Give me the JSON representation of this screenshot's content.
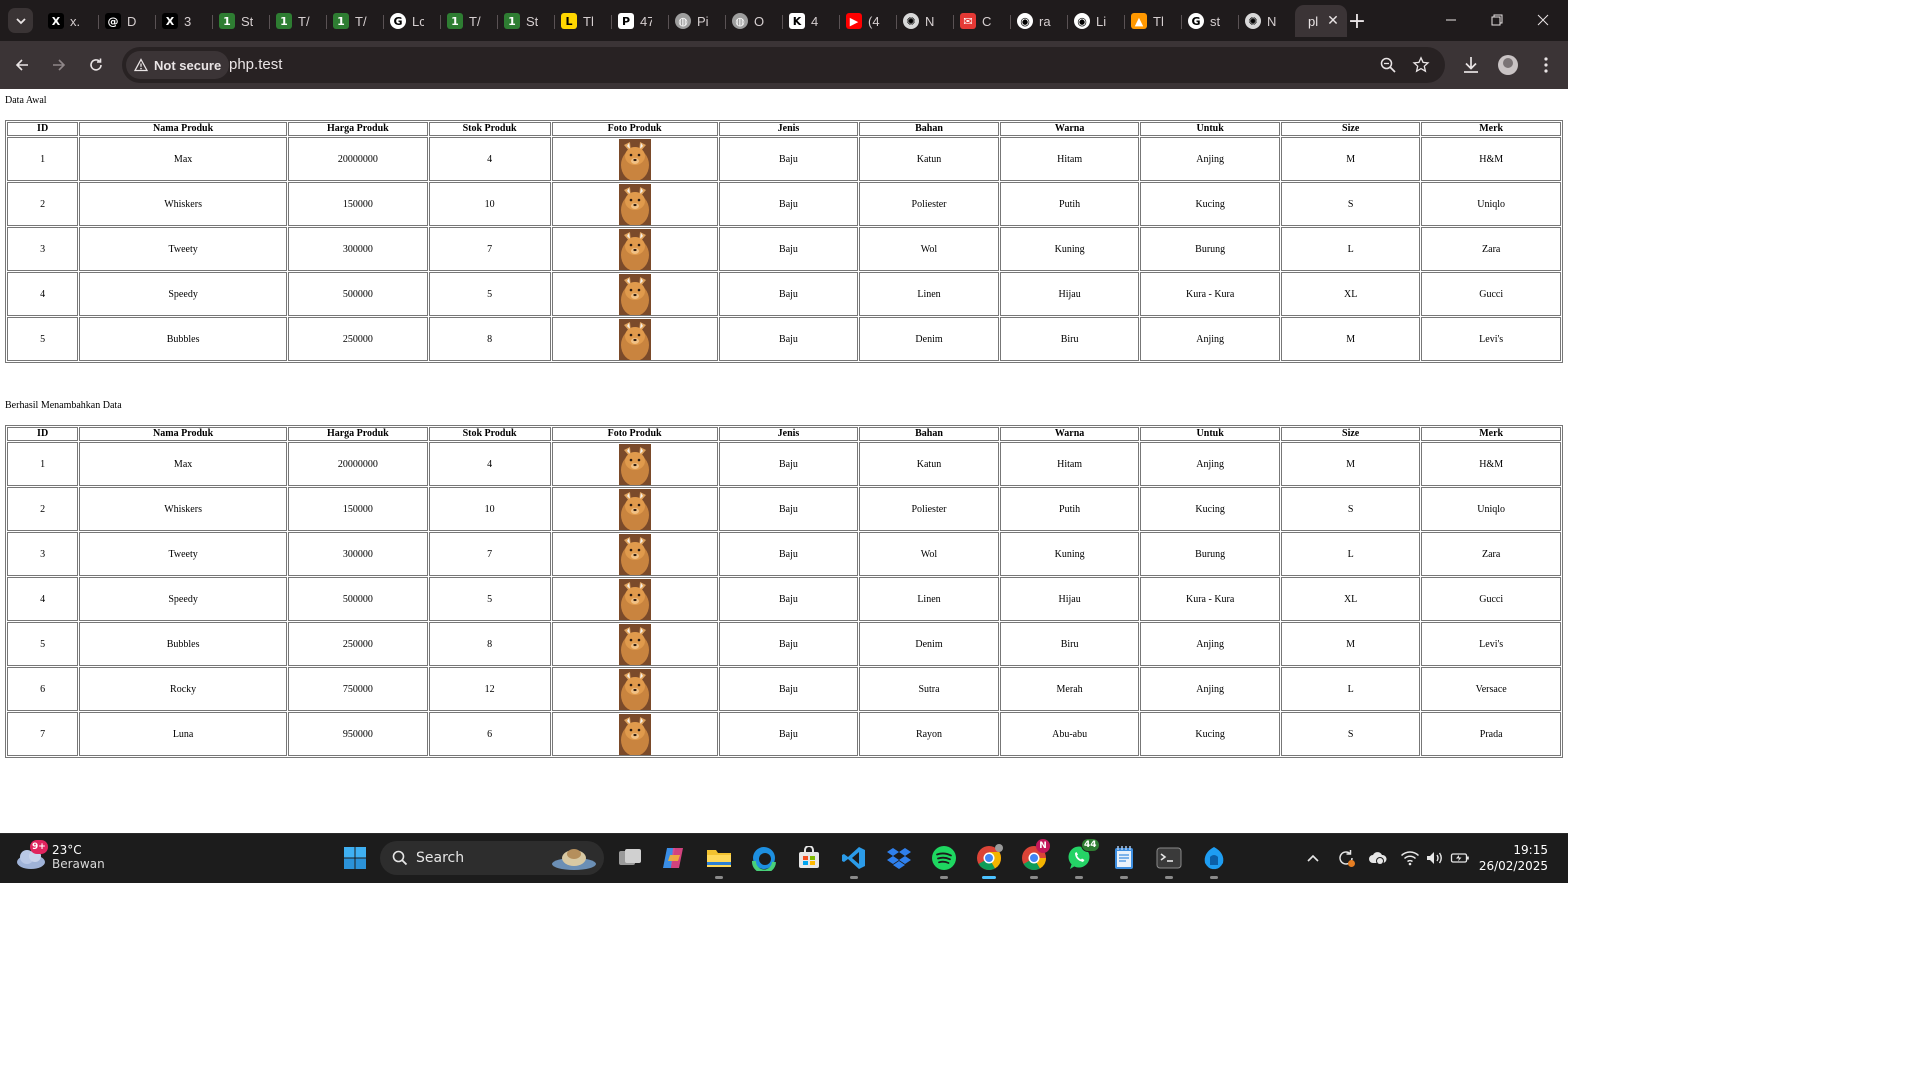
{
  "browser": {
    "tabs": [
      {
        "title": "x.",
        "icon": "x-logo-icon",
        "color": "#000000",
        "glyph": "X"
      },
      {
        "title": "D",
        "icon": "threads-icon",
        "color": "#000000",
        "glyph": "@"
      },
      {
        "title": "3",
        "icon": "x-logo-icon",
        "color": "#000000",
        "glyph": "X"
      },
      {
        "title": "St",
        "icon": "123dok-icon",
        "color": "#2e7d32",
        "glyph": "1"
      },
      {
        "title": "T/",
        "icon": "123dok-icon",
        "color": "#2e7d32",
        "glyph": "1"
      },
      {
        "title": "T/",
        "icon": "123dok-icon",
        "color": "#2e7d32",
        "glyph": "1"
      },
      {
        "title": "Lc",
        "icon": "google-icon",
        "color": "#ffffff",
        "glyph": "G"
      },
      {
        "title": "T/",
        "icon": "123dok-icon",
        "color": "#2e7d32",
        "glyph": "1"
      },
      {
        "title": "St",
        "icon": "123dok-icon",
        "color": "#2e7d32",
        "glyph": "1"
      },
      {
        "title": "Tl",
        "icon": "tl-icon",
        "color": "#ffd600",
        "glyph": "L"
      },
      {
        "title": "47",
        "icon": "pkp-icon",
        "color": "#ffffff",
        "glyph": "P"
      },
      {
        "title": "Pi",
        "icon": "globe-icon",
        "color": "#9e9e9e",
        "glyph": "◍"
      },
      {
        "title": "O",
        "icon": "globe-icon",
        "color": "#9e9e9e",
        "glyph": "◍"
      },
      {
        "title": "4",
        "icon": "k-logo-icon",
        "color": "#ffffff",
        "glyph": "K"
      },
      {
        "title": "(4",
        "icon": "youtube-icon",
        "color": "#ff0000",
        "glyph": "▶"
      },
      {
        "title": "N",
        "icon": "openai-icon",
        "color": "#d9d9d9",
        "glyph": "✺"
      },
      {
        "title": "C",
        "icon": "mail-icon",
        "color": "#e53935",
        "glyph": "✉"
      },
      {
        "title": "ra",
        "icon": "github-icon",
        "color": "#ffffff",
        "glyph": "◉"
      },
      {
        "title": "Li",
        "icon": "github-icon",
        "color": "#ffffff",
        "glyph": "◉"
      },
      {
        "title": "Tl",
        "icon": "tl2-icon",
        "color": "#ff9800",
        "glyph": "▲"
      },
      {
        "title": "st",
        "icon": "google-icon",
        "color": "#ffffff",
        "glyph": "G"
      },
      {
        "title": "N",
        "icon": "openai-icon",
        "color": "#d9d9d9",
        "glyph": "✺"
      },
      {
        "title": "pl",
        "icon": "",
        "color": "",
        "glyph": "",
        "active": true
      }
    ],
    "security_label": "Not secure",
    "url": "php.test"
  },
  "page": {
    "caption_initial": "Data Awal",
    "caption_added": "Berhasil Menambahkan Data",
    "columns": [
      "ID",
      "Nama Produk",
      "Harga Produk",
      "Stok Produk",
      "Foto Produk",
      "Jenis",
      "Bahan",
      "Warna",
      "Untuk",
      "Size",
      "Merk"
    ],
    "table_initial": [
      [
        "1",
        "Max",
        "20000000",
        "4",
        "",
        "Baju",
        "Katun",
        "Hitam",
        "Anjing",
        "M",
        "H&M"
      ],
      [
        "2",
        "Whiskers",
        "150000",
        "10",
        "",
        "Baju",
        "Poliester",
        "Putih",
        "Kucing",
        "S",
        "Uniqlo"
      ],
      [
        "3",
        "Tweety",
        "300000",
        "7",
        "",
        "Baju",
        "Wol",
        "Kuning",
        "Burung",
        "L",
        "Zara"
      ],
      [
        "4",
        "Speedy",
        "500000",
        "5",
        "",
        "Baju",
        "Linen",
        "Hijau",
        "Kura - Kura",
        "XL",
        "Gucci"
      ],
      [
        "5",
        "Bubbles",
        "250000",
        "8",
        "",
        "Baju",
        "Denim",
        "Biru",
        "Anjing",
        "M",
        "Levi's"
      ]
    ],
    "table_added": [
      [
        "1",
        "Max",
        "20000000",
        "4",
        "",
        "Baju",
        "Katun",
        "Hitam",
        "Anjing",
        "M",
        "H&M"
      ],
      [
        "2",
        "Whiskers",
        "150000",
        "10",
        "",
        "Baju",
        "Poliester",
        "Putih",
        "Kucing",
        "S",
        "Uniqlo"
      ],
      [
        "3",
        "Tweety",
        "300000",
        "7",
        "",
        "Baju",
        "Wol",
        "Kuning",
        "Burung",
        "L",
        "Zara"
      ],
      [
        "4",
        "Speedy",
        "500000",
        "5",
        "",
        "Baju",
        "Linen",
        "Hijau",
        "Kura - Kura",
        "XL",
        "Gucci"
      ],
      [
        "5",
        "Bubbles",
        "250000",
        "8",
        "",
        "Baju",
        "Denim",
        "Biru",
        "Anjing",
        "M",
        "Levi's"
      ],
      [
        "6",
        "Rocky",
        "750000",
        "12",
        "",
        "Baju",
        "Sutra",
        "Merah",
        "Anjing",
        "L",
        "Versace"
      ],
      [
        "7",
        "Luna",
        "950000",
        "6",
        "",
        "Baju",
        "Rayon",
        "Abu-abu",
        "Kucing",
        "S",
        "Prada"
      ]
    ]
  },
  "taskbar": {
    "weather_temp": "23°C",
    "weather_condition": "Berawan",
    "weather_badge": "9+",
    "search_label": "Search",
    "chrome_badge": "N",
    "whatsapp_badge": "44",
    "time": "19:15",
    "date": "26/02/2025"
  },
  "colors": {
    "tabstrip_bg": "#1f1b1c",
    "toolbar_bg": "#3b3436",
    "taskbar_bg": "#1c1c1c",
    "accent": "#4cc2ff"
  }
}
